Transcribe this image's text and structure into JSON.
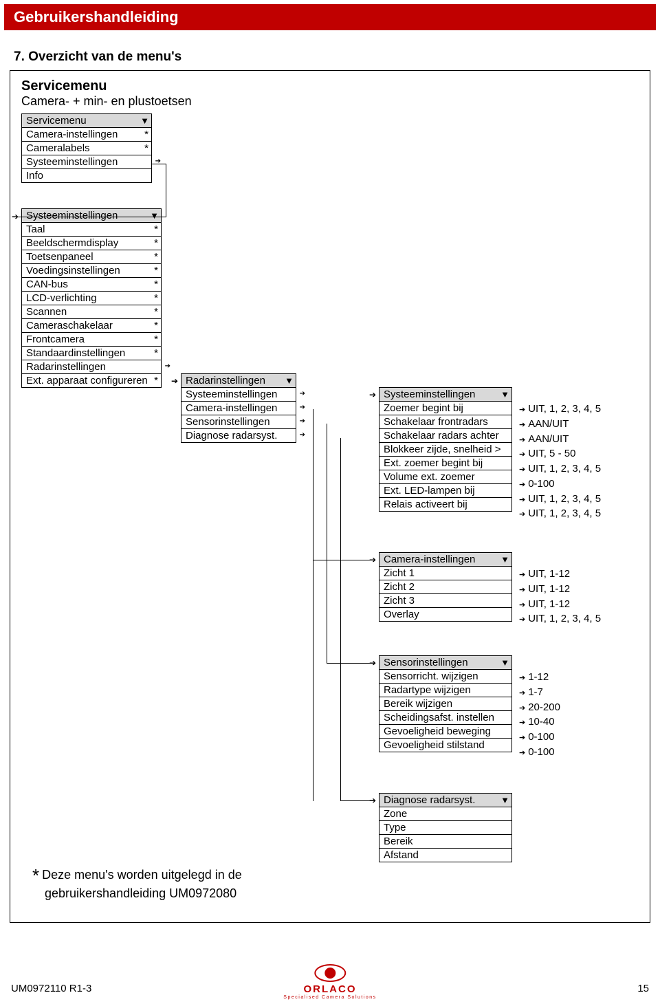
{
  "banner_title": "Gebruikershandleiding",
  "section_title": "7. Overzicht van de menu's",
  "servicemenu_title": "Servicemenu",
  "servicemenu_sub": "Camera- + min- en plustoetsen",
  "box_servicemenu": {
    "title": "Servicemenu",
    "items": [
      {
        "label": "Camera-instellingen",
        "star": true
      },
      {
        "label": "Cameralabels",
        "star": true
      },
      {
        "label": "Systeeminstellingen"
      },
      {
        "label": "Info"
      }
    ]
  },
  "box_systeem": {
    "title": "Systeeminstellingen",
    "items": [
      {
        "label": "Taal",
        "star": true
      },
      {
        "label": "Beeldschermdisplay",
        "star": true
      },
      {
        "label": "Toetsenpaneel",
        "star": true
      },
      {
        "label": "Voedingsinstellingen",
        "star": true
      },
      {
        "label": "CAN-bus",
        "star": true
      },
      {
        "label": "LCD-verlichting",
        "star": true
      },
      {
        "label": "Scannen",
        "star": true
      },
      {
        "label": "Cameraschakelaar",
        "star": true
      },
      {
        "label": "Frontcamera",
        "star": true
      },
      {
        "label": "Standaardinstellingen",
        "star": true
      },
      {
        "label": "Radarinstellingen"
      },
      {
        "label": "Ext. apparaat configureren",
        "star": true
      }
    ]
  },
  "box_radar": {
    "title": "Radarinstellingen",
    "items": [
      {
        "label": "Systeeminstellingen"
      },
      {
        "label": "Camera-instellingen"
      },
      {
        "label": "Sensorinstellingen"
      },
      {
        "label": "Diagnose radarsyst."
      }
    ]
  },
  "box_sys2": {
    "title": "Systeeminstellingen",
    "items": [
      {
        "label": "Zoemer begint bij"
      },
      {
        "label": "Schakelaar frontradars"
      },
      {
        "label": "Schakelaar radars achter"
      },
      {
        "label": "Blokkeer zijde, snelheid >"
      },
      {
        "label": "Ext. zoemer begint bij"
      },
      {
        "label": "Volume ext. zoemer"
      },
      {
        "label": "Ext. LED-lampen bij"
      },
      {
        "label": "Relais activeert bij"
      }
    ]
  },
  "opts_sys2": [
    "UIT, 1, 2, 3, 4, 5",
    "AAN/UIT",
    "AAN/UIT",
    "UIT, 5 - 50",
    "UIT, 1, 2, 3, 4, 5",
    "0-100",
    "UIT, 1, 2, 3, 4, 5",
    "UIT, 1, 2, 3, 4, 5"
  ],
  "box_camera": {
    "title": "Camera-instellingen",
    "items": [
      {
        "label": "Zicht 1"
      },
      {
        "label": "Zicht 2"
      },
      {
        "label": "Zicht 3"
      },
      {
        "label": "Overlay"
      }
    ]
  },
  "opts_camera": [
    "UIT, 1-12",
    "UIT, 1-12",
    "UIT, 1-12",
    "UIT, 1, 2, 3, 4, 5"
  ],
  "box_sensor": {
    "title": "Sensorinstellingen",
    "items": [
      {
        "label": "Sensorricht. wijzigen"
      },
      {
        "label": "Radartype wijzigen"
      },
      {
        "label": "Bereik wijzigen"
      },
      {
        "label": "Scheidingsafst. instellen"
      },
      {
        "label": "Gevoeligheid beweging"
      },
      {
        "label": "Gevoeligheid stilstand"
      }
    ]
  },
  "opts_sensor": [
    "1-12",
    "1-7",
    "20-200",
    "10-40",
    "0-100",
    "0-100"
  ],
  "box_diag": {
    "title": "Diagnose radarsyst.",
    "items": [
      {
        "label": "Zone"
      },
      {
        "label": "Type"
      },
      {
        "label": "Bereik"
      },
      {
        "label": "Afstand"
      }
    ]
  },
  "footnote_line1": "Deze menu's worden uitgelegd in de",
  "footnote_line2": "gebruikershandleiding UM0972080",
  "footer_id": "UM0972110 R1-3",
  "footer_page": "15",
  "logo_name": "ORLACO",
  "logo_tag": "Specialised Camera Solutions"
}
